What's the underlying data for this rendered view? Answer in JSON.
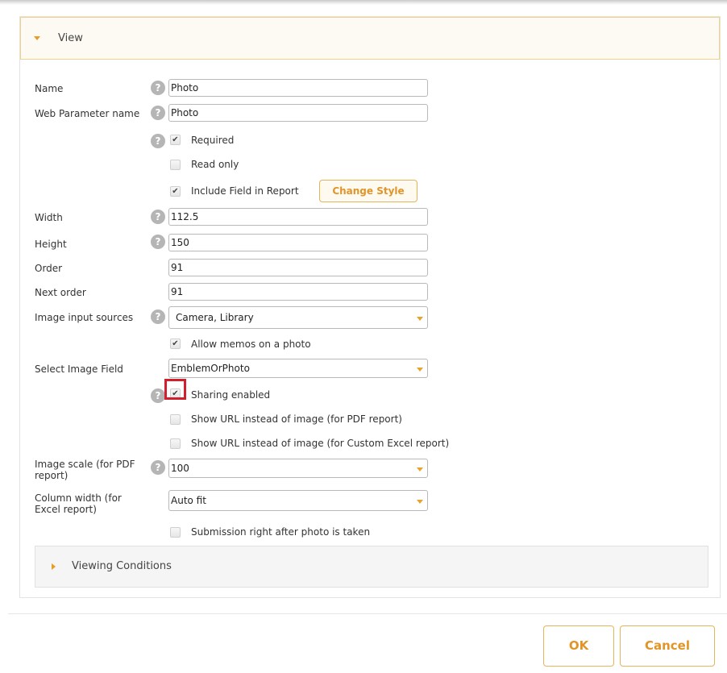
{
  "panel": {
    "title": "View"
  },
  "form": {
    "name": {
      "label": "Name",
      "value": "Photo"
    },
    "web_param": {
      "label": "Web Parameter name",
      "value": "Photo"
    },
    "required": {
      "label": "Required",
      "checked": true
    },
    "read_only": {
      "label": "Read only",
      "checked": false
    },
    "include_in_report": {
      "label": "Include Field in Report",
      "checked": true
    },
    "change_style_label": "Change Style",
    "width": {
      "label": "Width",
      "value": "112.5"
    },
    "height": {
      "label": "Height",
      "value": "150"
    },
    "order": {
      "label": "Order",
      "value": "91"
    },
    "next_order": {
      "label": "Next order",
      "value": "91"
    },
    "image_sources": {
      "label": "Image input sources",
      "value": "Camera, Library"
    },
    "allow_memos": {
      "label": "Allow memos on a photo",
      "checked": true
    },
    "select_image_field": {
      "label": "Select Image Field",
      "value": "EmblemOrPhoto"
    },
    "sharing": {
      "label": "Sharing enabled",
      "checked": true
    },
    "show_url_pdf": {
      "label": "Show URL instead of image (for PDF report)",
      "checked": false
    },
    "show_url_excel": {
      "label": "Show URL instead of image (for Custom Excel report)",
      "checked": false
    },
    "image_scale": {
      "label_line1": "Image scale (for PDF",
      "label_line2": "report)",
      "value": "100"
    },
    "column_width": {
      "label_line1": "Column width (for",
      "label_line2": "Excel report)",
      "value": "Auto fit"
    },
    "submission": {
      "label": "Submission right after photo is taken",
      "checked": false
    }
  },
  "viewing_conditions": {
    "title": "Viewing Conditions"
  },
  "buttons": {
    "ok": "OK",
    "cancel": "Cancel"
  },
  "help_glyph": "?",
  "check_glyph": "✔",
  "colors": {
    "accent": "#e89c21",
    "highlight": "#d11f2d"
  }
}
